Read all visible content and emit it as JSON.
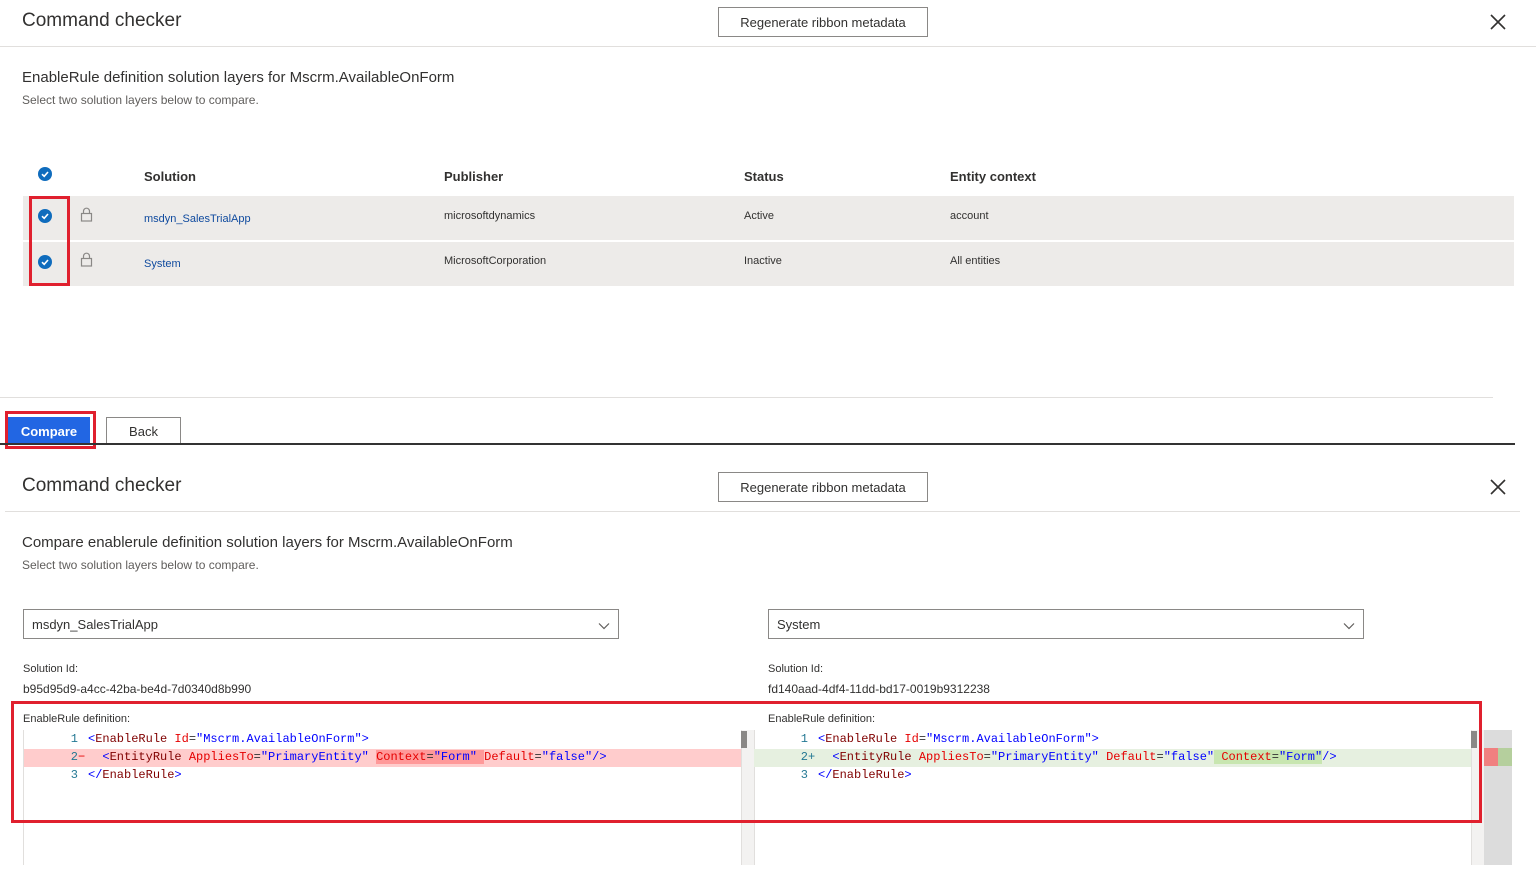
{
  "top_panel": {
    "title": "Command checker",
    "regen_button": "Regenerate ribbon metadata",
    "heading": "EnableRule definition solution layers for Mscrm.AvailableOnForm",
    "subheading": "Select two solution layers below to compare.",
    "columns": [
      "Solution",
      "Publisher",
      "Status",
      "Entity context"
    ],
    "rows": [
      {
        "solution": "msdyn_SalesTrialApp",
        "publisher": "microsoftdynamics",
        "status": "Active",
        "entity_context": "account"
      },
      {
        "solution": "System",
        "publisher": "MicrosoftCorporation",
        "status": "Inactive",
        "entity_context": "All entities"
      }
    ],
    "compare_button": "Compare",
    "back_button": "Back"
  },
  "bottom_panel": {
    "title": "Command checker",
    "regen_button": "Regenerate ribbon metadata",
    "heading": "Compare enablerule definition solution layers for Mscrm.AvailableOnForm",
    "subheading": "Select two solution layers below to compare.",
    "left": {
      "dropdown_value": "msdyn_SalesTrialApp",
      "solution_id_label": "Solution Id:",
      "solution_id": "b95d95d9-a4cc-42ba-be4d-7d0340d8b990",
      "definition_label": "EnableRule definition:"
    },
    "right": {
      "dropdown_value": "System",
      "solution_id_label": "Solution Id:",
      "solution_id": "fd140aad-4df4-11dd-bd17-0019b9312238",
      "definition_label": "EnableRule definition:"
    },
    "diff": {
      "left_lines": [
        {
          "num": "1",
          "marker": "",
          "text": "<EnableRule Id=\"Mscrm.AvailableOnForm\">"
        },
        {
          "num": "2",
          "marker": "−",
          "text": "  <EntityRule AppliesTo=\"PrimaryEntity\" Context=\"Form\" Default=\"false\"/>"
        },
        {
          "num": "3",
          "marker": "",
          "text": "</EnableRule>"
        }
      ],
      "right_lines": [
        {
          "num": "1",
          "marker": "",
          "text": "<EnableRule Id=\"Mscrm.AvailableOnForm\">"
        },
        {
          "num": "2",
          "marker": "+",
          "text": "  <EntityRule AppliesTo=\"PrimaryEntity\" Default=\"false\" Context=\"Form\"/>"
        },
        {
          "num": "3",
          "marker": "",
          "text": "</EnableRule>"
        }
      ]
    }
  },
  "colors": {
    "primary": "#2266e3",
    "highlight_box": "#e0202e",
    "row_bg": "#edebe9",
    "deleted_bg": "#ffcccc",
    "added_bg": "#e6f0e0"
  }
}
